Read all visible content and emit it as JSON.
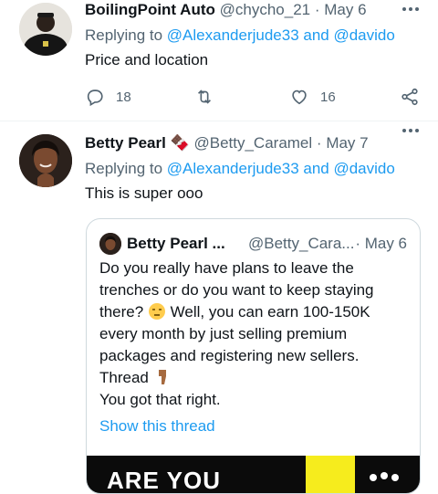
{
  "tweets": [
    {
      "name": "BoilingPoint Auto",
      "handle": "@chycho_21",
      "separator": "·",
      "date": "May 6",
      "replying_prefix": "Replying to",
      "replying_to": "@Alexanderjude33 and @davido",
      "text": "Price and location",
      "replies": "18",
      "likes": "16",
      "icons": [
        "reply-icon",
        "retweet-icon",
        "like-icon",
        "share-icon",
        "more-icon"
      ]
    },
    {
      "name": "Betty Pearl",
      "name_emoji": "🍫",
      "handle": "@Betty_Caramel",
      "separator": "·",
      "date": "May 7",
      "replying_prefix": "Replying to",
      "replying_to": "@Alexanderjude33 and @davido",
      "text": "This is super ooo",
      "quote": {
        "name": "Betty Pearl ...",
        "handle": "@Betty_Cara...",
        "date": "· May 6",
        "line1": "Do you really have plans to leave the trenches or do you want to keep staying there?",
        "line1b": "Well, you can earn 100-150K every month by just selling premium packages and registering new sellers.",
        "line2": "Thread",
        "line3": "You got that right.",
        "show_thread": "Show this thread",
        "media_text": "ARE YOU"
      }
    }
  ],
  "colors": {
    "link": "#1d9bf0",
    "muted": "#536471",
    "text": "#0f1419"
  }
}
